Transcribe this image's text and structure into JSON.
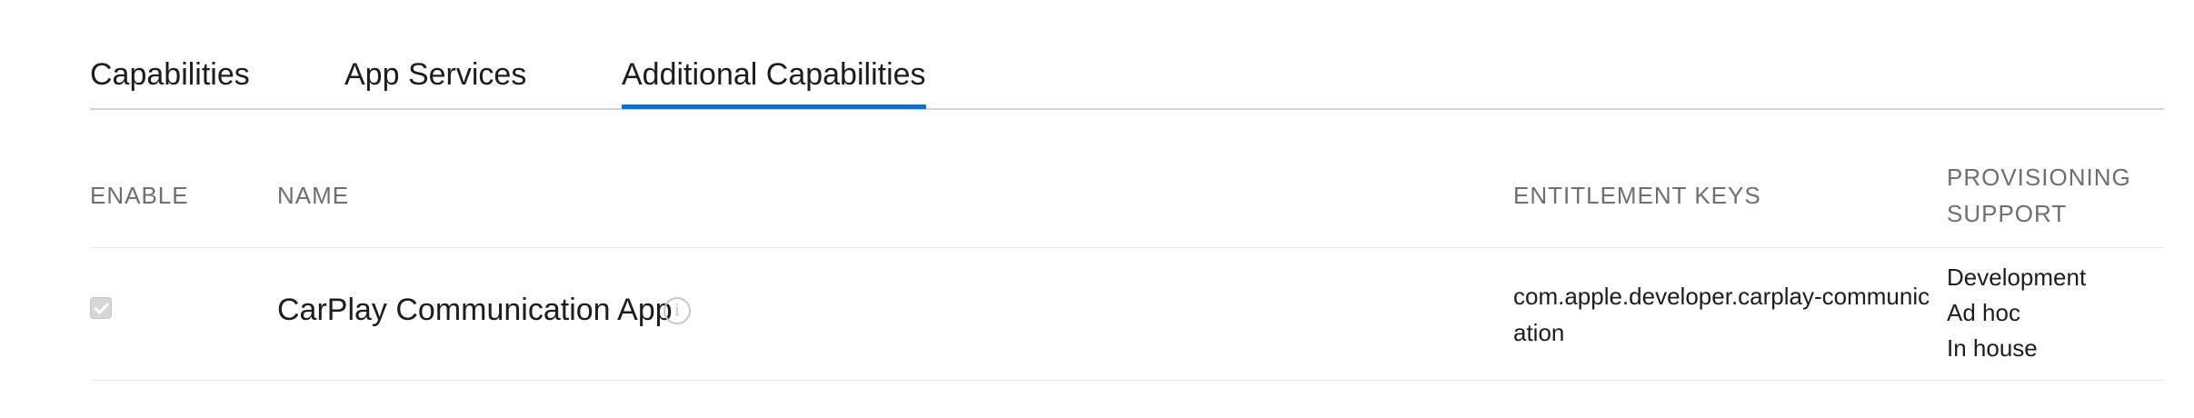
{
  "tabs": [
    {
      "label": "Capabilities"
    },
    {
      "label": "App Services"
    },
    {
      "label": "Additional Capabilities",
      "active": true
    }
  ],
  "table": {
    "headers": {
      "enable": "ENABLE",
      "name": "NAME",
      "entitlement_keys": "ENTITLEMENT KEYS",
      "provisioning_support": "PROVISIONING SUPPORT"
    },
    "rows": [
      {
        "enabled": true,
        "disabled": true,
        "name": "CarPlay Communication App",
        "info_icon": "info-circle-icon",
        "entitlement_key": "com.apple.developer.carplay-communication",
        "provisioning": [
          "Development",
          "Ad hoc",
          "In house"
        ]
      }
    ]
  },
  "colors": {
    "accent": "#0071e3",
    "text": "#1d1d1f",
    "header_text": "#6e6e73",
    "divider": "#d2d2d7"
  }
}
